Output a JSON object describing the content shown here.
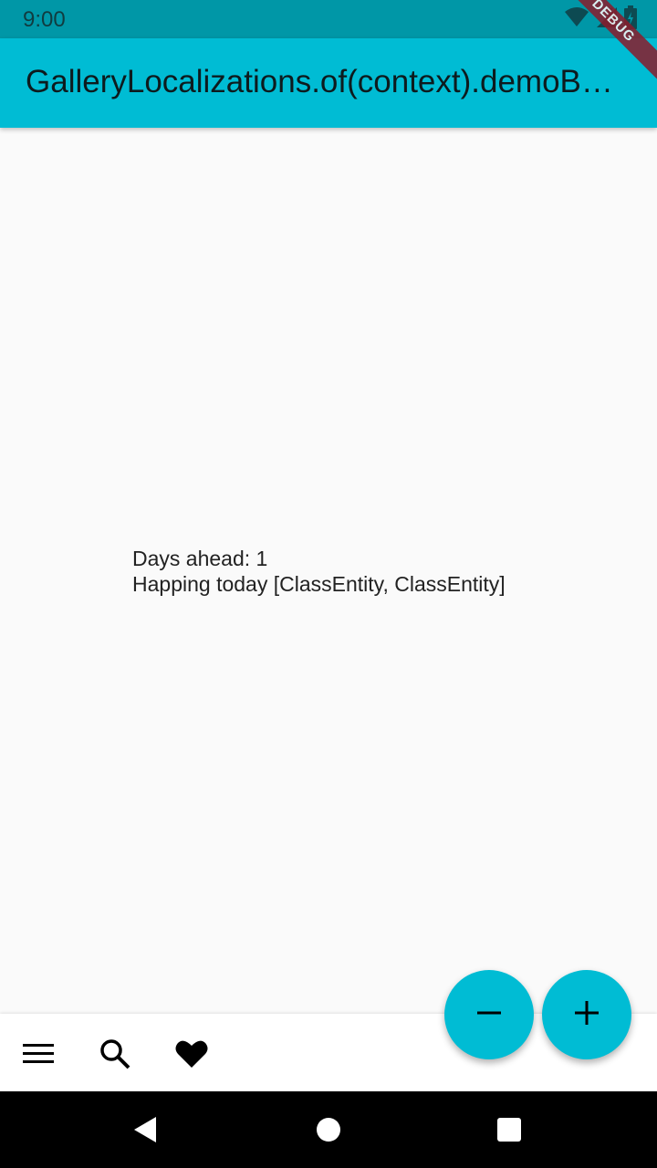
{
  "status_bar": {
    "time": "9:00",
    "icons": [
      "wifi-icon",
      "no-signal-icon",
      "battery-charging-icon"
    ]
  },
  "app_bar": {
    "title": "GalleryLocalizations.of(context).demoB…"
  },
  "debug_banner": {
    "label": "DEBUG"
  },
  "content": {
    "days_ahead": "Days ahead: 1",
    "happening": "Happing today [ClassEntity, ClassEntity]"
  },
  "bottom_bar": {
    "icons": [
      "menu-icon",
      "search-icon",
      "heart-icon"
    ]
  },
  "fabs": [
    "minus-icon",
    "plus-icon"
  ],
  "nav_bar": [
    "back-icon",
    "home-icon",
    "recents-icon"
  ],
  "colors": {
    "accent": "#00bcd4",
    "status_bar": "#0097a7",
    "background": "#fafafa",
    "debug": "#8b1c2c"
  }
}
